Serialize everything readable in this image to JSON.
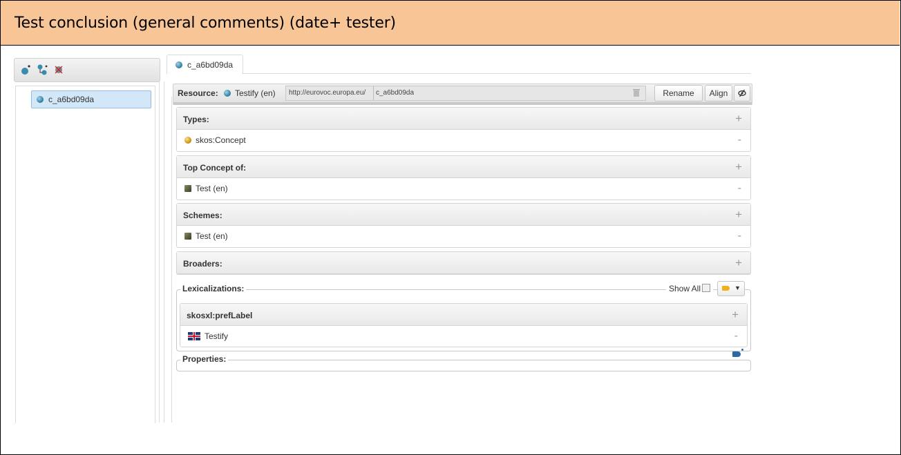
{
  "document": {
    "heading": "Test conclusion (general comments) (date+ tester)"
  },
  "left_panel": {
    "toolbar_icons": [
      "create-concept-icon",
      "create-narrower-icon",
      "delete-concept-icon"
    ],
    "tree": [
      {
        "label": "c_a6bd09da"
      }
    ]
  },
  "tab": {
    "label": "c_a6bd09da"
  },
  "resource": {
    "label": "Resource:",
    "name": "Testify (en)",
    "namespace": "http://eurovoc.europa.eu/",
    "local_name": "c_a6bd09da",
    "rename_label": "Rename",
    "align_label": "Align"
  },
  "sections": {
    "types": {
      "title": "Types:",
      "value": "skos:Concept",
      "add": "+",
      "remove": "-"
    },
    "top_concept": {
      "title": "Top Concept of:",
      "value": "Test (en)",
      "add": "+",
      "remove": "-"
    },
    "schemes": {
      "title": "Schemes:",
      "value": "Test (en)",
      "add": "+",
      "remove": "-"
    },
    "broaders": {
      "title": "Broaders:",
      "add": "+"
    }
  },
  "lexicalizations": {
    "title": "Lexicalizations:",
    "show_all": "Show All",
    "pref_label": {
      "title": "skosxl:prefLabel",
      "value": "Testify",
      "add": "+",
      "remove": "-"
    }
  },
  "properties": {
    "title": "Properties:"
  },
  "colors": {
    "header_bg": "#f8c597",
    "selection": "#d2e7f8",
    "concept_dot": "#2a7a9a"
  }
}
